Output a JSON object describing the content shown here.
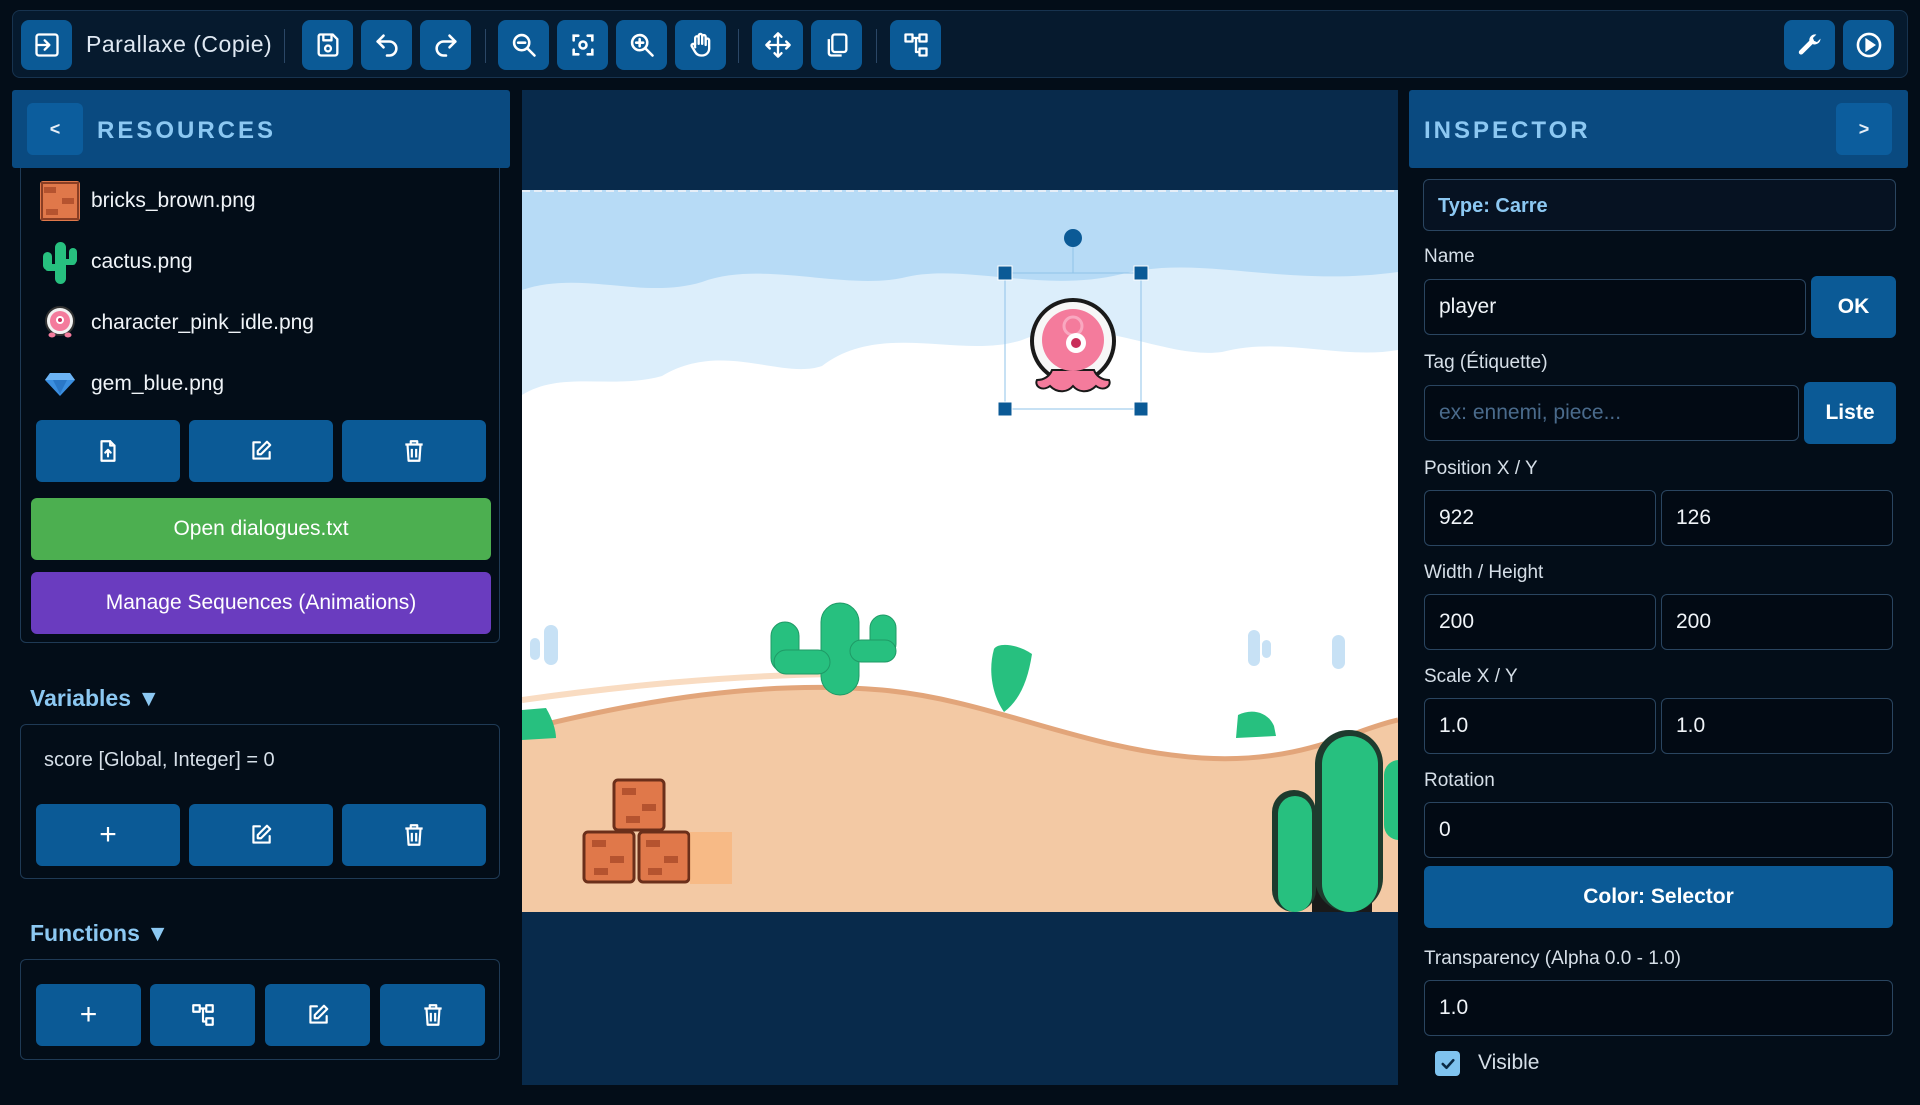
{
  "toolbar": {
    "project_title": "Parallaxe (Copie)",
    "buttons": [
      "exit-icon",
      "save-icon",
      "undo-icon",
      "redo-icon",
      "zoom-out-icon",
      "zoom-fit-icon",
      "zoom-in-icon",
      "pan-hand-icon",
      "move-icon",
      "duplicate-icon",
      "hierarchy-icon",
      "wrench-icon",
      "play-icon"
    ]
  },
  "resources": {
    "collapse_label": "<",
    "title": "RESOURCES",
    "items": [
      {
        "name": "bricks_brown.png",
        "icon": "bricks-thumbnail"
      },
      {
        "name": "cactus.png",
        "icon": "cactus-thumbnail"
      },
      {
        "name": "character_pink_idle.png",
        "icon": "character-thumbnail"
      },
      {
        "name": "gem_blue.png",
        "icon": "gem-thumbnail"
      }
    ],
    "open_dialogues_label": "Open dialogues.txt",
    "manage_sequences_label": "Manage Sequences (Animations)",
    "colors": {
      "green": "#4caf50",
      "purple": "#6a3cbf",
      "action": "#0b5a96"
    }
  },
  "variables": {
    "title": "Variables ▼",
    "items": [
      "score [Global, Integer] = 0"
    ],
    "add_label": "+"
  },
  "functions": {
    "title": "Functions ▼",
    "add_label": "+"
  },
  "inspector": {
    "collapse_label": ">",
    "title": "INSPECTOR",
    "type_text": "Type: Carre",
    "name_label": "Name",
    "name_value": "player",
    "ok_label": "OK",
    "tag_label": "Tag (Étiquette)",
    "tag_placeholder": "ex: ennemi, piece...",
    "tag_list_label": "Liste",
    "position_label": "Position X / Y",
    "position_x": "922",
    "position_y": "126",
    "size_label": "Width / Height",
    "width": "200",
    "height": "200",
    "scale_label": "Scale X / Y",
    "scale_x": "1.0",
    "scale_y": "1.0",
    "rotation_label": "Rotation",
    "rotation": "0",
    "color_button_label": "Color: Selector",
    "alpha_label": "Transparency (Alpha 0.0 - 1.0)",
    "alpha": "1.0",
    "visible_label": "Visible",
    "visible_checked": true
  }
}
